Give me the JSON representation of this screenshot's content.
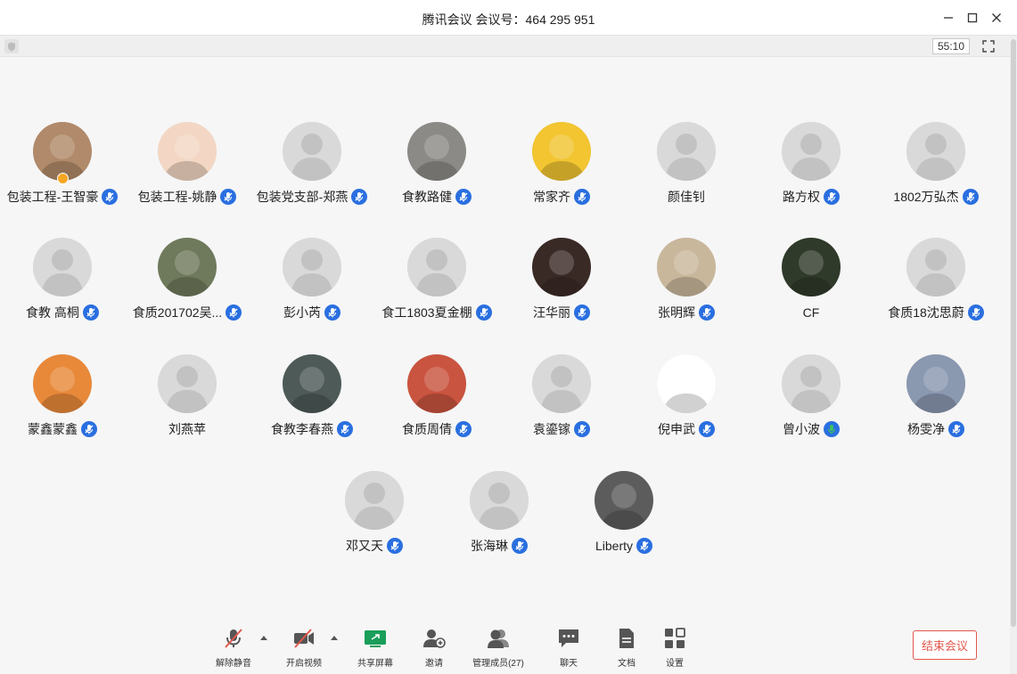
{
  "window": {
    "title": "腾讯会议 会议号：464 295 951",
    "timer": "55:10"
  },
  "participants": [
    {
      "name": "包装工程-王智豪",
      "mic": "muted",
      "avatar": "photo-dog",
      "color": "#b08a6a",
      "badges": [
        "host"
      ]
    },
    {
      "name": "包装工程-姚静",
      "mic": "muted",
      "avatar": "photo-cartoon-girl",
      "color": "#f3d7c4"
    },
    {
      "name": "包装党支部-郑燕",
      "mic": "muted",
      "avatar": "default"
    },
    {
      "name": "食教路健",
      "mic": "muted",
      "avatar": "photo-street",
      "color": "#8c8a86"
    },
    {
      "name": "常家齐",
      "mic": "muted",
      "avatar": "photo-pikachu",
      "color": "#f2c531"
    },
    {
      "name": "颜佳钊",
      "mic": "none",
      "avatar": "default"
    },
    {
      "name": "路方权",
      "mic": "muted",
      "avatar": "default"
    },
    {
      "name": "1802万弘杰",
      "mic": "muted",
      "avatar": "default"
    },
    {
      "name": "食教 高桐",
      "mic": "muted",
      "avatar": "default"
    },
    {
      "name": "食质201702吴...",
      "mic": "muted",
      "avatar": "photo-food",
      "color": "#6f7a5c"
    },
    {
      "name": "彭小芮",
      "mic": "muted",
      "avatar": "default"
    },
    {
      "name": "食工1803夏金棚",
      "mic": "muted",
      "avatar": "default"
    },
    {
      "name": "汪华丽",
      "mic": "muted",
      "avatar": "photo-woman",
      "color": "#3a2a26"
    },
    {
      "name": "张明辉",
      "mic": "muted",
      "avatar": "photo-guitar",
      "color": "#c9b79c"
    },
    {
      "name": "CF",
      "mic": "none",
      "avatar": "photo-joker",
      "color": "#2f3a2a"
    },
    {
      "name": "食质18沈思蔚",
      "mic": "muted",
      "avatar": "default"
    },
    {
      "name": "蒙鑫蒙鑫",
      "mic": "muted",
      "avatar": "photo-orange-shirt",
      "color": "#e8893a"
    },
    {
      "name": "刘燕苹",
      "mic": "none",
      "avatar": "default"
    },
    {
      "name": "食教李春燕",
      "mic": "muted",
      "avatar": "photo-costume",
      "color": "#4e5a58"
    },
    {
      "name": "食质周倩",
      "mic": "muted",
      "avatar": "photo-boy",
      "color": "#c9543f"
    },
    {
      "name": "袁鎏镓",
      "mic": "muted",
      "avatar": "default"
    },
    {
      "name": "倪申武",
      "mic": "muted",
      "avatar": "photo-sketch",
      "color": "#ffffff"
    },
    {
      "name": "曾小波",
      "mic": "speaking",
      "avatar": "default"
    },
    {
      "name": "杨雯净",
      "mic": "muted",
      "avatar": "photo-field",
      "color": "#8a98b0"
    },
    {
      "name": "邓又天",
      "mic": "muted",
      "avatar": "default"
    },
    {
      "name": "张海琳",
      "mic": "muted",
      "avatar": "default"
    },
    {
      "name": "Liberty",
      "mic": "muted",
      "avatar": "photo-bw",
      "color": "#5c5c5c"
    }
  ],
  "toolbar": {
    "unmute": "解除静音",
    "start_video": "开启视频",
    "share_screen": "共享屏幕",
    "invite": "邀请",
    "manage_members": "管理成员(27)",
    "chat": "聊天",
    "docs": "文档",
    "settings": "设置",
    "end_meeting": "结束会议"
  },
  "colors": {
    "accent": "#2a6fe0",
    "end_red": "#e2574c",
    "speaking_green": "#3fbf5f",
    "share_green": "#1a9e5a"
  }
}
